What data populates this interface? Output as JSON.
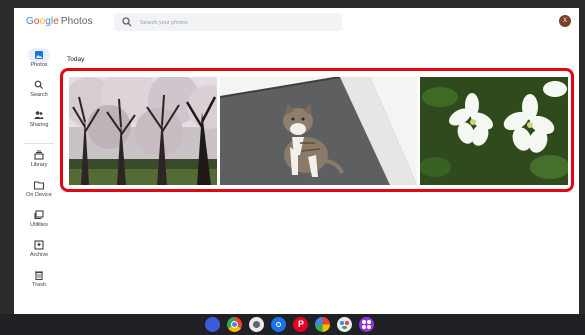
{
  "app": {
    "logo": "Google Photos"
  },
  "search": {
    "placeholder": "Search your photos"
  },
  "avatar": {
    "initial": "X",
    "color": "#7b3f2a"
  },
  "sidebar": {
    "items": [
      {
        "label": "Photos",
        "icon": "photos-icon",
        "active": true
      },
      {
        "label": "Search",
        "icon": "search-icon"
      },
      {
        "label": "Sharing",
        "icon": "sharing-icon"
      },
      {
        "label": "Library",
        "icon": "library-icon"
      },
      {
        "label": "On Device",
        "icon": "folder-icon"
      },
      {
        "label": "Utilities",
        "icon": "utilities-icon"
      },
      {
        "label": "Archive",
        "icon": "archive-icon"
      },
      {
        "label": "Trash",
        "icon": "trash-icon"
      }
    ]
  },
  "main": {
    "section_title": "Today",
    "photos": [
      {
        "subject": "cherry-blossom-trees"
      },
      {
        "subject": "tabby-cat"
      },
      {
        "subject": "white-flowers"
      }
    ],
    "highlight_color": "#e30613"
  },
  "taskbar": {
    "apps": [
      {
        "icon": "launcher-icon",
        "color": "#3b5bdb"
      },
      {
        "icon": "chrome-icon",
        "color": "#fbbc05"
      },
      {
        "icon": "camera-icon",
        "color": "#5f6368"
      },
      {
        "icon": "settings-icon",
        "color": "#1a73e8"
      },
      {
        "icon": "pinterest-icon",
        "color": "#e60023"
      },
      {
        "icon": "photos-app-icon",
        "color": "#34a853"
      },
      {
        "icon": "assistant-icon",
        "color": "#4285f4"
      },
      {
        "icon": "apps-icon",
        "color": "#9334e6"
      }
    ]
  }
}
